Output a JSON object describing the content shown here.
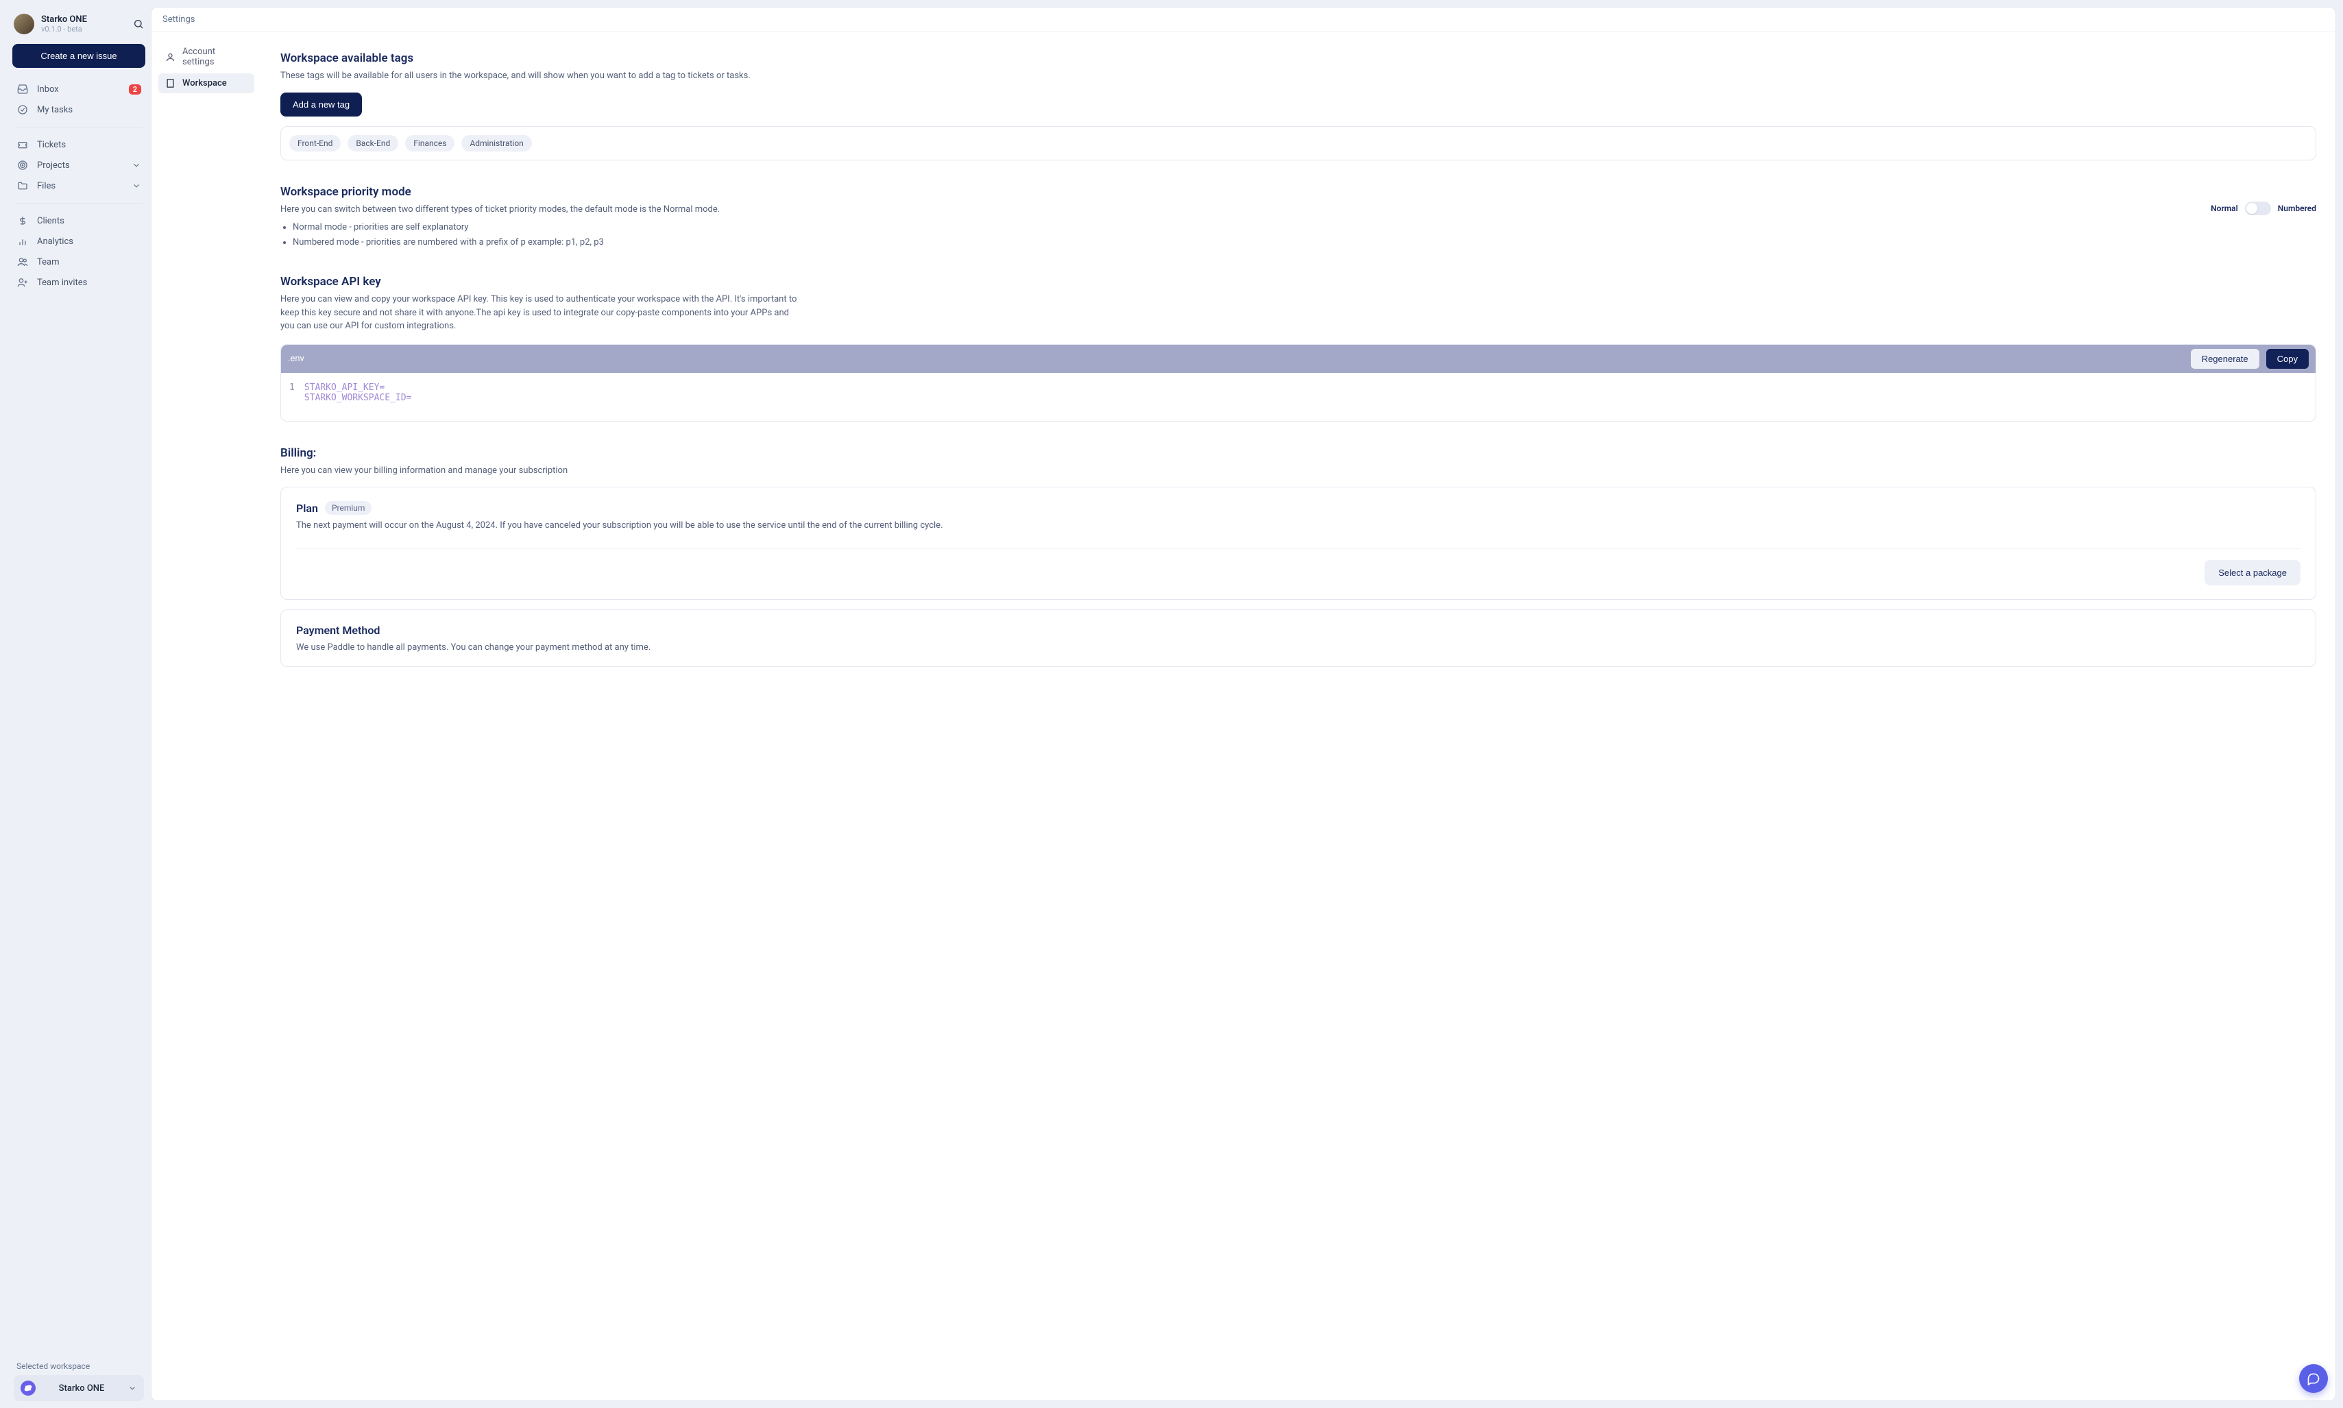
{
  "sidebar": {
    "workspace_name": "Starko ONE",
    "version": "v0.1.0 - beta",
    "create_issue": "Create a new issue",
    "nav": {
      "inbox": "Inbox",
      "inbox_badge": "2",
      "my_tasks": "My tasks",
      "tickets": "Tickets",
      "projects": "Projects",
      "files": "Files",
      "clients": "Clients",
      "analytics": "Analytics",
      "team": "Team",
      "team_invites": "Team invites"
    },
    "footer_label": "Selected workspace",
    "selected_workspace": "Starko ONE"
  },
  "header": {
    "title": "Settings"
  },
  "settings_nav": {
    "account": "Account settings",
    "workspace": "Workspace"
  },
  "tags_section": {
    "title": "Workspace available tags",
    "desc": "These tags will be available for all users in the workspace, and will show when you want to add a tag to tickets or tasks.",
    "add_btn": "Add a new tag",
    "tags": [
      "Front-End",
      "Back-End",
      "Finances",
      "Administration"
    ]
  },
  "priority_section": {
    "title": "Workspace priority mode",
    "desc": "Here you can switch between two different types of ticket priority modes, the default mode is the Normal mode.",
    "bullets": [
      "Normal mode - priorities are self explanatory",
      "Numbered mode - priorities are numbered with a prefix of p example: p1, p2, p3"
    ],
    "label_normal": "Normal",
    "label_numbered": "Numbered"
  },
  "api_section": {
    "title": "Workspace API key",
    "desc": "Here you can view and copy your workspace API key. This key is used to authenticate your workspace with the API. It's important to keep this key secure and not share it with anyone.The api key is used to integrate our copy-paste components into your APPs and you can use our API for custom integrations.",
    "filename": ".env",
    "regen_btn": "Regenerate",
    "copy_btn": "Copy",
    "line_no": "1",
    "code": "STARKO_API_KEY=\nSTARKO_WORKSPACE_ID="
  },
  "billing_section": {
    "title": "Billing:",
    "desc": "Here you can view your billing information and manage your subscription",
    "plan_label": "Plan",
    "plan_badge": "Premium",
    "plan_desc": "The next payment will occur on the August 4, 2024. If you have canceled your subscription you will be able to use the service until the end of the current billing cycle.",
    "select_pkg": "Select a package",
    "payment_title": "Payment Method",
    "payment_desc": "We use Paddle to handle all payments. You can change your payment method at any time."
  }
}
